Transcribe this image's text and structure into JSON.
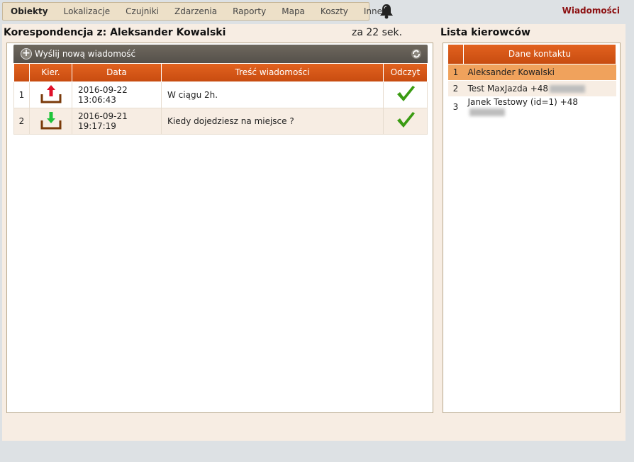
{
  "nav": {
    "items": [
      "Obiekty",
      "Lokalizacje",
      "Czujniki",
      "Zdarzenia",
      "Raporty",
      "Mapa",
      "Koszty",
      "Inne"
    ],
    "active": "Obiekty",
    "right_link": "Wiadomości",
    "bell_icon": "bell-icon"
  },
  "conversation": {
    "title": "Korespondencja z: Aleksander Kowalski",
    "refresh_timer": "za 22 sek.",
    "send_button": "Wyślij nową wiadomość",
    "columns": [
      "",
      "Kier.",
      "Data",
      "Treść wiadomości",
      "Odczyt"
    ],
    "rows": [
      {
        "num": "1",
        "direction": "outgoing",
        "date": "2016-09-22 13:06:43",
        "text": "W ciągu 2h.",
        "read": true
      },
      {
        "num": "2",
        "direction": "incoming",
        "date": "2016-09-21 19:17:19",
        "text": "Kiedy dojedziesz na miejsce ?",
        "read": true
      }
    ]
  },
  "drivers": {
    "title": "Lista kierowców",
    "column": "Dane kontaktu",
    "rows": [
      {
        "num": "1",
        "label": "Aleksander Kowalski"
      },
      {
        "num": "2",
        "label": "Test MaxJazda +48"
      },
      {
        "num": "3",
        "label": "Janek Testowy (id=1) +48"
      }
    ]
  },
  "colors": {
    "header_orange": "#d9561a",
    "selected_row": "#f0a25c",
    "panel_bg": "#f7ede3",
    "link_red": "#8c0f10",
    "check_green": "#3a9b12"
  }
}
